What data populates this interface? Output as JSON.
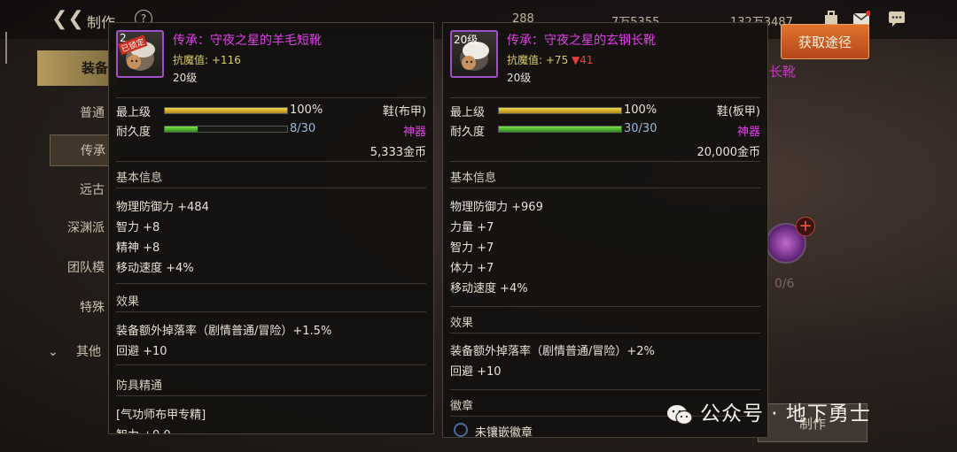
{
  "header": {
    "title": "制作",
    "help": "?",
    "currencies": [
      "288",
      "7万5355",
      "132万3487"
    ]
  },
  "sidebar": {
    "category": "装备",
    "items": [
      {
        "label": "普通"
      },
      {
        "label": "传承"
      },
      {
        "label": "远古"
      },
      {
        "label": "深渊派"
      },
      {
        "label": "团队模"
      },
      {
        "label": "特殊"
      }
    ],
    "other": "其他"
  },
  "actions": {
    "obtain": "获取途径",
    "craft": "制作",
    "material_count": "0/6",
    "background_name_fragment": "长靴"
  },
  "left_item": {
    "icon_level": "2",
    "icon_stamp": "已锁定",
    "name": "传承：守夜之星的羊毛短靴",
    "anti_magic_label": "抗魔值:",
    "anti_magic_value": "+116",
    "level": "20级",
    "max_level_label": "最上级",
    "max_level_value": "100%",
    "max_level_fill": 1.0,
    "durability_label": "耐久度",
    "durability_value": "8/30",
    "durability_fill": 0.2667,
    "type": "鞋(布甲)",
    "rarity": "神器",
    "price": "5,333金币",
    "basic_title": "基本信息",
    "stats": [
      "物理防御力 +484",
      "智力 +8",
      "精神 +8",
      "移动速度 +4%"
    ],
    "effect_title": "效果",
    "effects": [
      "装备额外掉落率（剧情普通/冒险）+1.5%",
      "回避 +10"
    ],
    "mastery_title": "防具精通",
    "mastery_line": "[气功师布甲专精]",
    "cut_line": "智力 +0.0"
  },
  "right_item": {
    "icon_level": "20级",
    "name": "传承：守夜之星的玄钢长靴",
    "anti_magic_label": "抗魔值:",
    "anti_magic_value": "+75",
    "anti_magic_change": "▼41",
    "level": "20级",
    "max_level_label": "最上级",
    "max_level_value": "100%",
    "max_level_fill": 1.0,
    "durability_label": "耐久度",
    "durability_value": "30/30",
    "durability_fill": 1.0,
    "type": "鞋(板甲)",
    "rarity": "神器",
    "price": "20,000金币",
    "basic_title": "基本信息",
    "stats": [
      "物理防御力 +969",
      "力量 +7",
      "智力 +7",
      "体力 +7",
      "移动速度 +4%"
    ],
    "effect_title": "效果",
    "effects": [
      "装备额外掉落率（剧情普通/冒险）+2%",
      "回避 +10"
    ],
    "emblem_title": "徽章",
    "emblem_line": "未镶嵌徽章"
  },
  "watermark": "公众号 · 地下勇士",
  "colors": {
    "epic_name": "#e040e8",
    "anti_magic": "#d8cc6a",
    "down_arrow": "#e84040",
    "button_orange": "#c85a22"
  }
}
